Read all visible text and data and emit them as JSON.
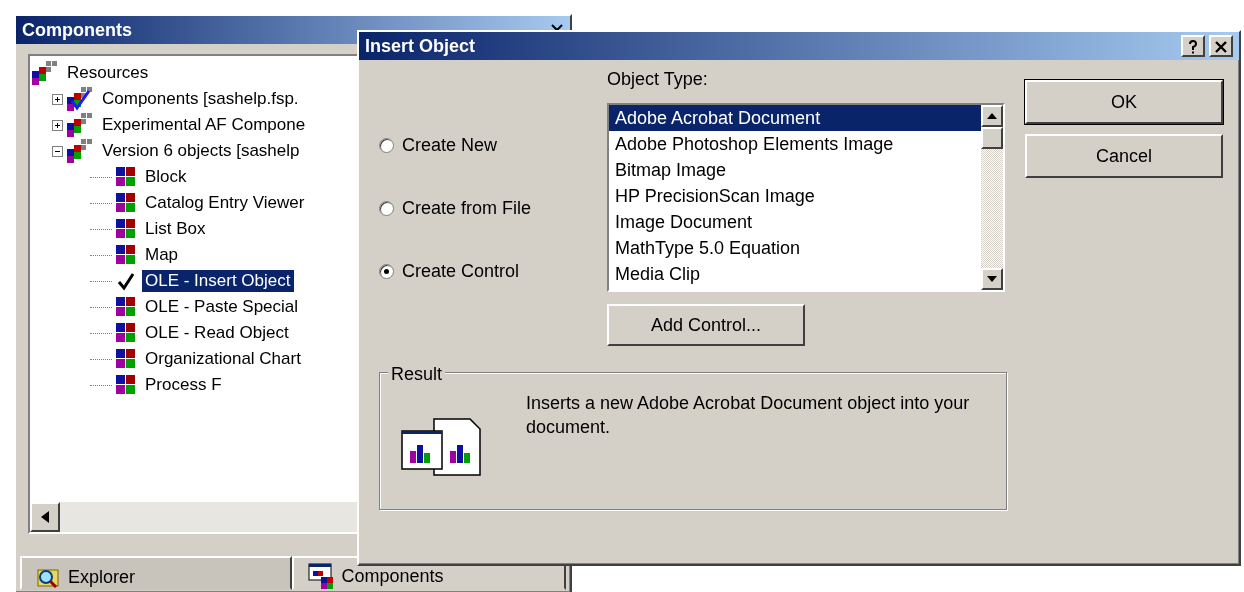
{
  "components_window": {
    "title": "Components",
    "tree": [
      {
        "label": "Resources",
        "kind": "folder",
        "children": [
          {
            "label": "Components [sashelp.fsp.",
            "kind": "checkedfolder",
            "expanded": false
          },
          {
            "label": "Experimental AF Compone",
            "kind": "folder",
            "expanded": false
          },
          {
            "label": "Version 6 objects [sashelp",
            "kind": "folder",
            "expanded": true,
            "children": [
              {
                "label": "Block",
                "kind": "block",
                "selected": false
              },
              {
                "label": "Catalog Entry Viewer",
                "kind": "block",
                "selected": false
              },
              {
                "label": "List Box",
                "kind": "block",
                "selected": false
              },
              {
                "label": "Map",
                "kind": "block",
                "selected": false
              },
              {
                "label": "OLE - Insert Object",
                "kind": "check",
                "selected": true
              },
              {
                "label": "OLE - Paste Special",
                "kind": "block",
                "selected": false
              },
              {
                "label": "OLE - Read Object",
                "kind": "block",
                "selected": false
              },
              {
                "label": "Organizational Chart",
                "kind": "block",
                "selected": false
              },
              {
                "label": "Process F",
                "kind": "block",
                "selected": false
              }
            ]
          }
        ]
      }
    ],
    "tabs": [
      {
        "label": "Explorer",
        "selected": false
      },
      {
        "label": "Components",
        "selected": true
      }
    ]
  },
  "dialog": {
    "title": "Insert Object",
    "options": [
      {
        "label": "Create New",
        "selected": false
      },
      {
        "label": "Create from File",
        "selected": false
      },
      {
        "label": "Create Control",
        "selected": true
      }
    ],
    "object_type_label": "Object Type:",
    "object_types": [
      {
        "label": "Adobe Acrobat Document",
        "selected": true
      },
      {
        "label": "Adobe Photoshop Elements Image",
        "selected": false
      },
      {
        "label": "Bitmap Image",
        "selected": false
      },
      {
        "label": "HP PrecisionScan Image",
        "selected": false
      },
      {
        "label": "Image Document",
        "selected": false
      },
      {
        "label": "MathType 5.0 Equation",
        "selected": false
      },
      {
        "label": "Media Clip",
        "selected": false
      }
    ],
    "add_button": "Add Control...",
    "buttons": [
      "OK",
      "Cancel"
    ],
    "result": {
      "label": "Result",
      "text": "Inserts a new Adobe Acrobat Document object into your document."
    }
  }
}
